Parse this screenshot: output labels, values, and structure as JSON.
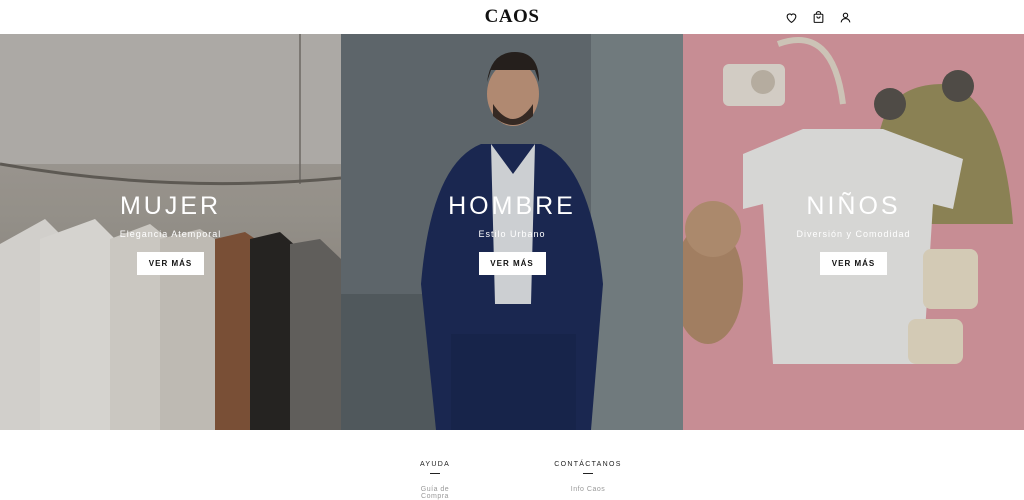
{
  "header": {
    "logo": "CAOS",
    "icons": [
      "heart-icon",
      "shopping-bag-icon",
      "user-icon"
    ]
  },
  "hero": {
    "panels": [
      {
        "title": "MUJER",
        "subtitle": "Elegancia Atemporal",
        "button": "VER MÁS"
      },
      {
        "title": "HOMBRE",
        "subtitle": "Estilo Urbano",
        "button": "VER MÁS"
      },
      {
        "title": "NIÑOS",
        "subtitle": "Diversión y Comodidad",
        "button": "VER MÁS"
      }
    ]
  },
  "footer": {
    "columns": [
      {
        "title": "AYUDA",
        "first_item": "Guía de Compra"
      },
      {
        "title": "CONTÁCTANOS",
        "first_item": "Info Caos"
      }
    ]
  },
  "colors": {
    "panel_mujer": "#a9a49c",
    "panel_hombre": "#59636a",
    "panel_ninos": "#c27f86",
    "button_bg": "#ffffff",
    "text": "#111111"
  }
}
